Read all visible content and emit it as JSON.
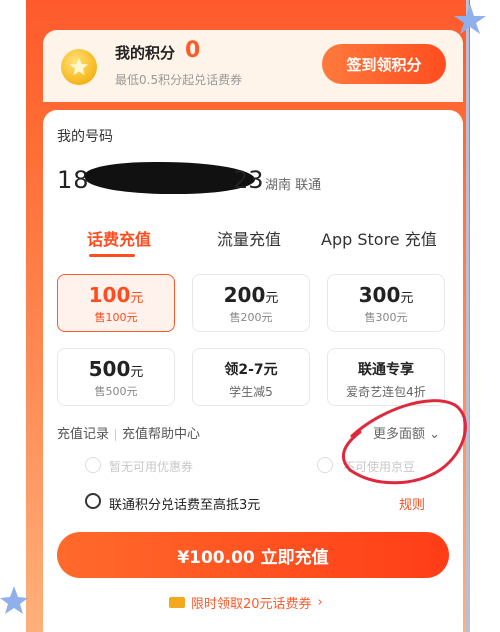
{
  "points": {
    "title": "我的积分",
    "value": "0",
    "subtitle": "最低0.5积分起兑话费券",
    "sign_button": "签到领积分"
  },
  "account": {
    "label": "我的号码",
    "number_prefix": "18",
    "number_suffix": "23",
    "carrier": "湖南 联通"
  },
  "tabs": [
    {
      "label": "话费充值"
    },
    {
      "label": "流量充值"
    },
    {
      "label": "App Store 充值"
    }
  ],
  "tiles": [
    {
      "amount": "100",
      "unit": "元",
      "price": "售100元"
    },
    {
      "amount": "200",
      "unit": "元",
      "price": "售200元"
    },
    {
      "amount": "300",
      "unit": "元",
      "price": "售300元"
    },
    {
      "amount": "500",
      "unit": "元",
      "price": "售500元"
    },
    {
      "amount": "领2-7元",
      "unit": "",
      "price": "学生减5"
    },
    {
      "amount": "联通专享",
      "unit": "",
      "price": "爱奇艺连包4折"
    }
  ],
  "links": {
    "history": "充值记录",
    "help": "充值帮助中心",
    "more": "更多面额"
  },
  "options": {
    "coupon_unavailable": "暂无可用优惠券",
    "jingdou_unavailable": "不可使用京豆",
    "points_offset": "联通积分兑话费至高抵3元",
    "rules": "规则"
  },
  "pay": {
    "label": "¥100.00 立即充值"
  },
  "coupon_banner": {
    "label": "限时领取20元话费券"
  },
  "colors": {
    "accent": "#ff4d1f",
    "frame": "#ff6a33"
  }
}
